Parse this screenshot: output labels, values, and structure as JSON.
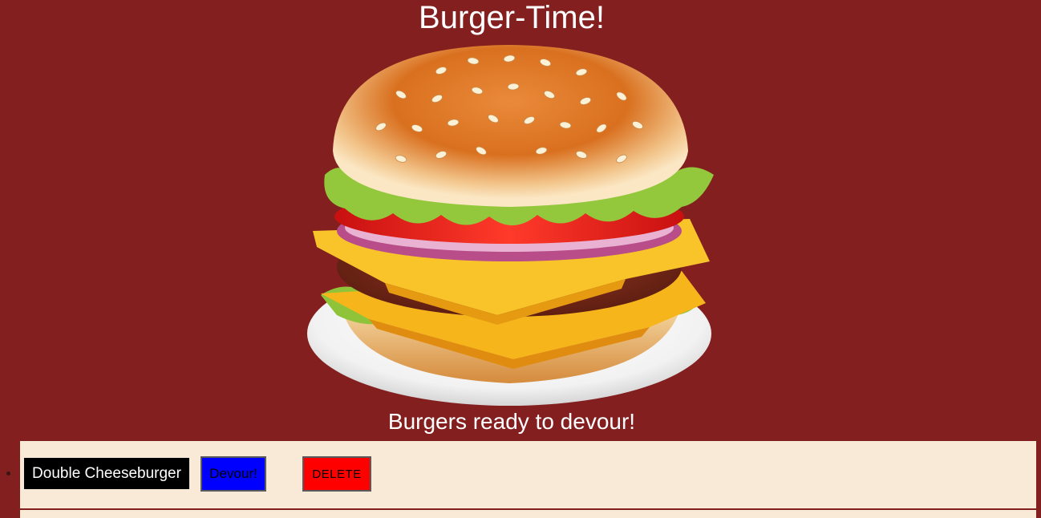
{
  "header": {
    "title": "Burger-Time!"
  },
  "hero": {
    "image": "burger-illustration"
  },
  "section": {
    "heading": "Burgers ready to devour!"
  },
  "burgers": [
    {
      "name": "Double Cheeseburger",
      "devour_label": "Devour!",
      "delete_label": "DELETE"
    }
  ],
  "colors": {
    "background": "#841f20",
    "row_background": "#f9ead7",
    "name_background": "#000000",
    "devour_button": "#0000ff",
    "delete_button": "#ff0000"
  }
}
